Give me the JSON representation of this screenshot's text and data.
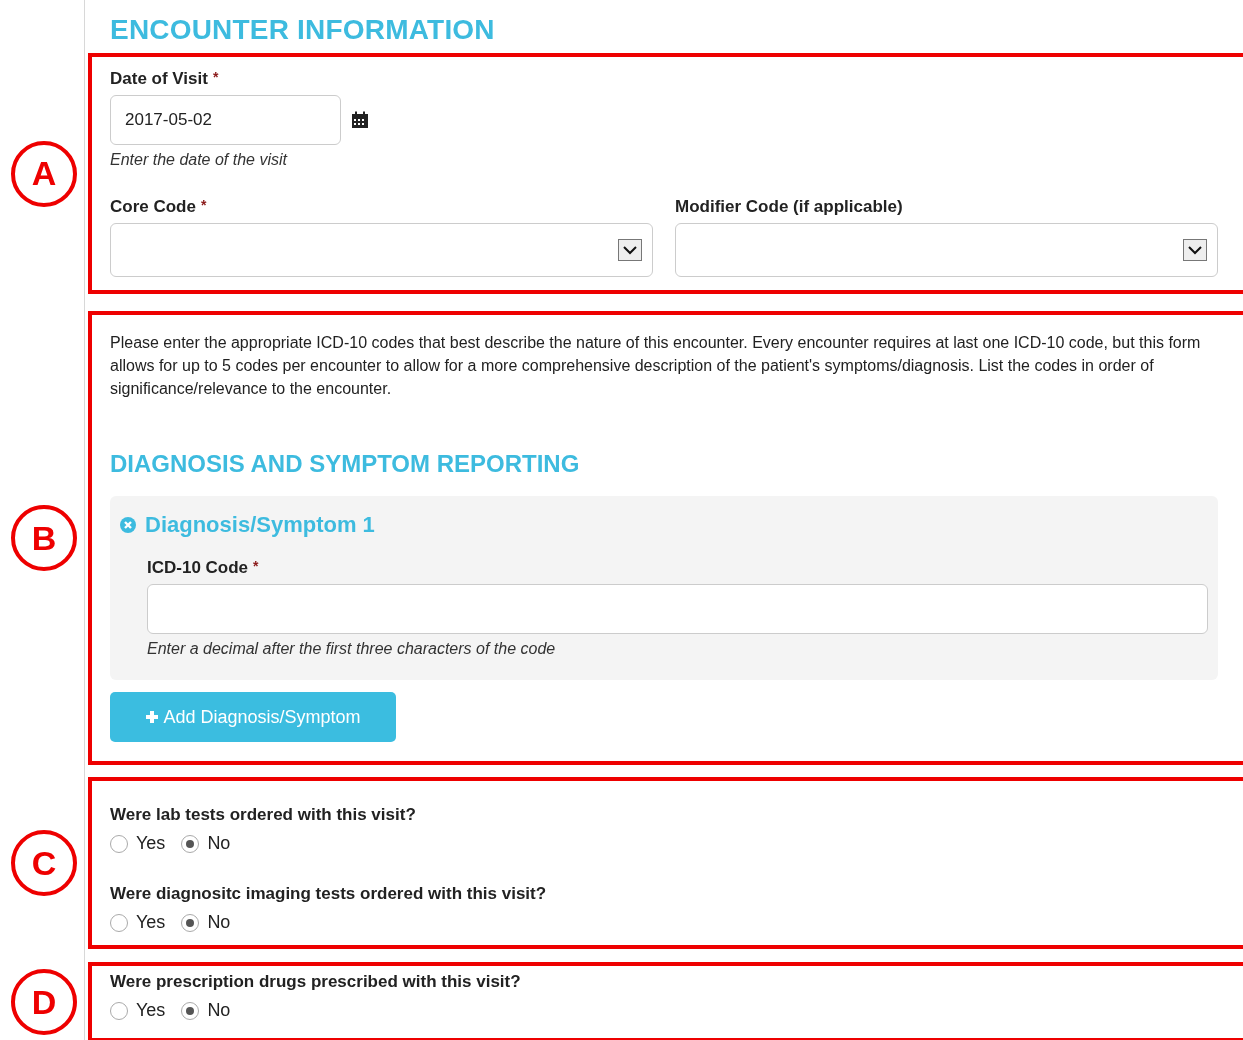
{
  "title": "ENCOUNTER INFORMATION",
  "section_a": {
    "marker": "A",
    "date_field": {
      "label": "Date of Visit",
      "required_mark": "*",
      "value": "2017-05-02",
      "help": "Enter the date of the visit"
    },
    "selects": [
      {
        "label": "Core Code",
        "required_mark": "*"
      },
      {
        "label": "Modifier Code (if applicable)"
      }
    ]
  },
  "section_b": {
    "marker": "B",
    "intro": "Please enter the appropriate ICD-10 codes that best describe the nature of this encounter. Every encounter requires at last one ICD-10 code, but this form allows for up to 5 codes per encounter to allow for a more comprehensive description of the patient's symptoms/diagnosis. List the codes in order of significance/relevance to the encounter.",
    "subheading": "DIAGNOSIS AND SYMPTOM REPORTING",
    "entries": [
      {
        "title": "Diagnosis/Symptom 1",
        "field": {
          "label": "ICD-10 Code",
          "required_mark": "*",
          "help": "Enter a decimal after the first three characters of the code"
        }
      }
    ],
    "add_button": "Add Diagnosis/Symptom"
  },
  "section_c": {
    "marker": "C",
    "questions": [
      {
        "text": "Were lab tests ordered with this visit?",
        "options": [
          {
            "label": "Yes",
            "selected": false
          },
          {
            "label": "No",
            "selected": true
          }
        ]
      },
      {
        "text": "Were diagnositc imaging tests ordered with this visit?",
        "options": [
          {
            "label": "Yes",
            "selected": false
          },
          {
            "label": "No",
            "selected": true
          }
        ]
      }
    ]
  },
  "section_d": {
    "marker": "D",
    "questions": [
      {
        "text": "Were prescription drugs prescribed with this visit?",
        "options": [
          {
            "label": "Yes",
            "selected": false
          },
          {
            "label": "No",
            "selected": true
          }
        ]
      }
    ]
  }
}
